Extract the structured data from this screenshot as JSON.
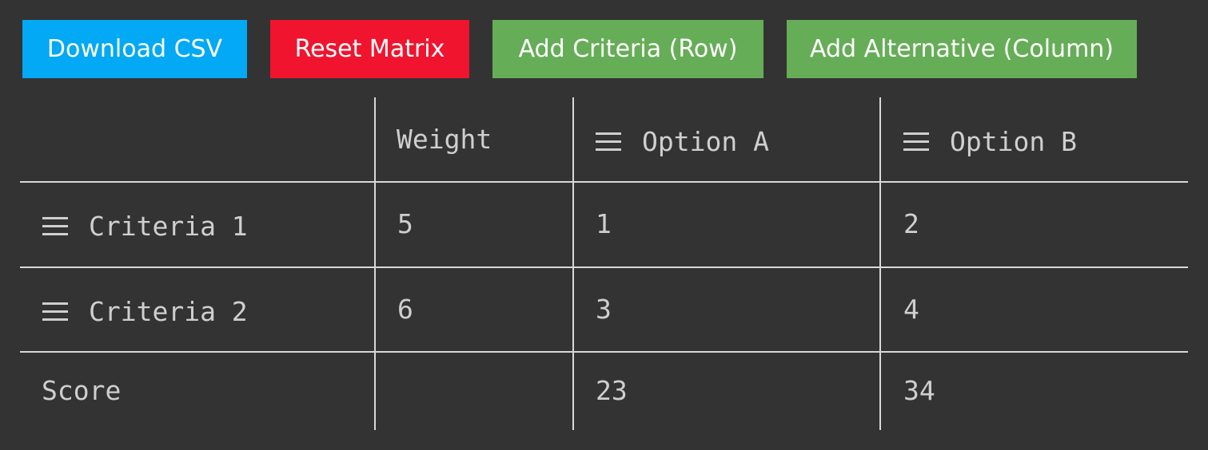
{
  "toolbar": {
    "download_label": "Download CSV",
    "reset_label": "Reset Matrix",
    "add_row_label": "Add Criteria (Row)",
    "add_col_label": "Add Alternative (Column)"
  },
  "colors": {
    "background": "#333333",
    "download": "#03a9f4",
    "reset": "#f0142e",
    "add": "#66ad57",
    "text": "#cfcfcf",
    "grid": "#d8d8d8"
  },
  "matrix": {
    "header": {
      "weight_label": "Weight",
      "alternatives": [
        "Option A",
        "Option B"
      ]
    },
    "rows": [
      {
        "label": "Criteria 1",
        "weight": "5",
        "values": [
          "1",
          "2"
        ]
      },
      {
        "label": "Criteria 2",
        "weight": "6",
        "values": [
          "3",
          "4"
        ]
      }
    ],
    "score": {
      "label": "Score",
      "values": [
        "23",
        "34"
      ]
    }
  }
}
